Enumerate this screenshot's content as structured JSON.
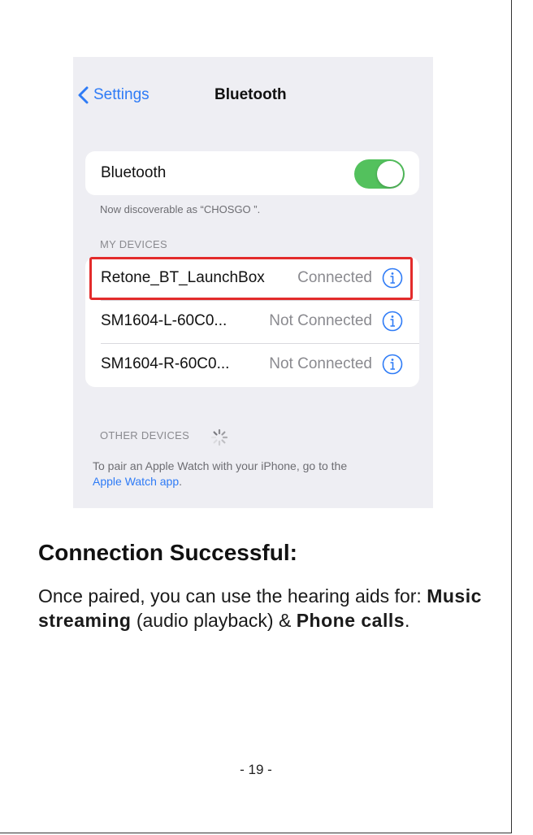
{
  "screenshot": {
    "nav": {
      "back_label": "Settings",
      "title": "Bluetooth"
    },
    "bluetooth_row": {
      "label": "Bluetooth",
      "toggle_on": true
    },
    "discoverable_note": "Now discoverable as “CHOSGO ”.",
    "my_devices_header": "MY DEVICES",
    "devices": [
      {
        "name": "Retone_BT_LaunchBox",
        "status": "Connected"
      },
      {
        "name": "SM1604-L-60C0...",
        "status": "Not Connected"
      },
      {
        "name": "SM1604-R-60C0...",
        "status": "Not Connected"
      }
    ],
    "other_devices_header": "OTHER DEVICES",
    "pair_text": "To pair an Apple Watch with your iPhone, go to the",
    "pair_link": "Apple Watch app",
    "pair_end": ".",
    "colors": {
      "accent": "#2e7bf6",
      "toggle": "#53c15d",
      "highlight": "#e32b2b"
    }
  },
  "document": {
    "heading": "Connection Successful:",
    "body_1": "Once paired, you can use the hearing aids for: ",
    "bold_1": "Music streaming",
    "body_2": " (audio playback) & ",
    "bold_2": "Phone calls",
    "body_3": ".",
    "page_number": "- 19 -"
  }
}
